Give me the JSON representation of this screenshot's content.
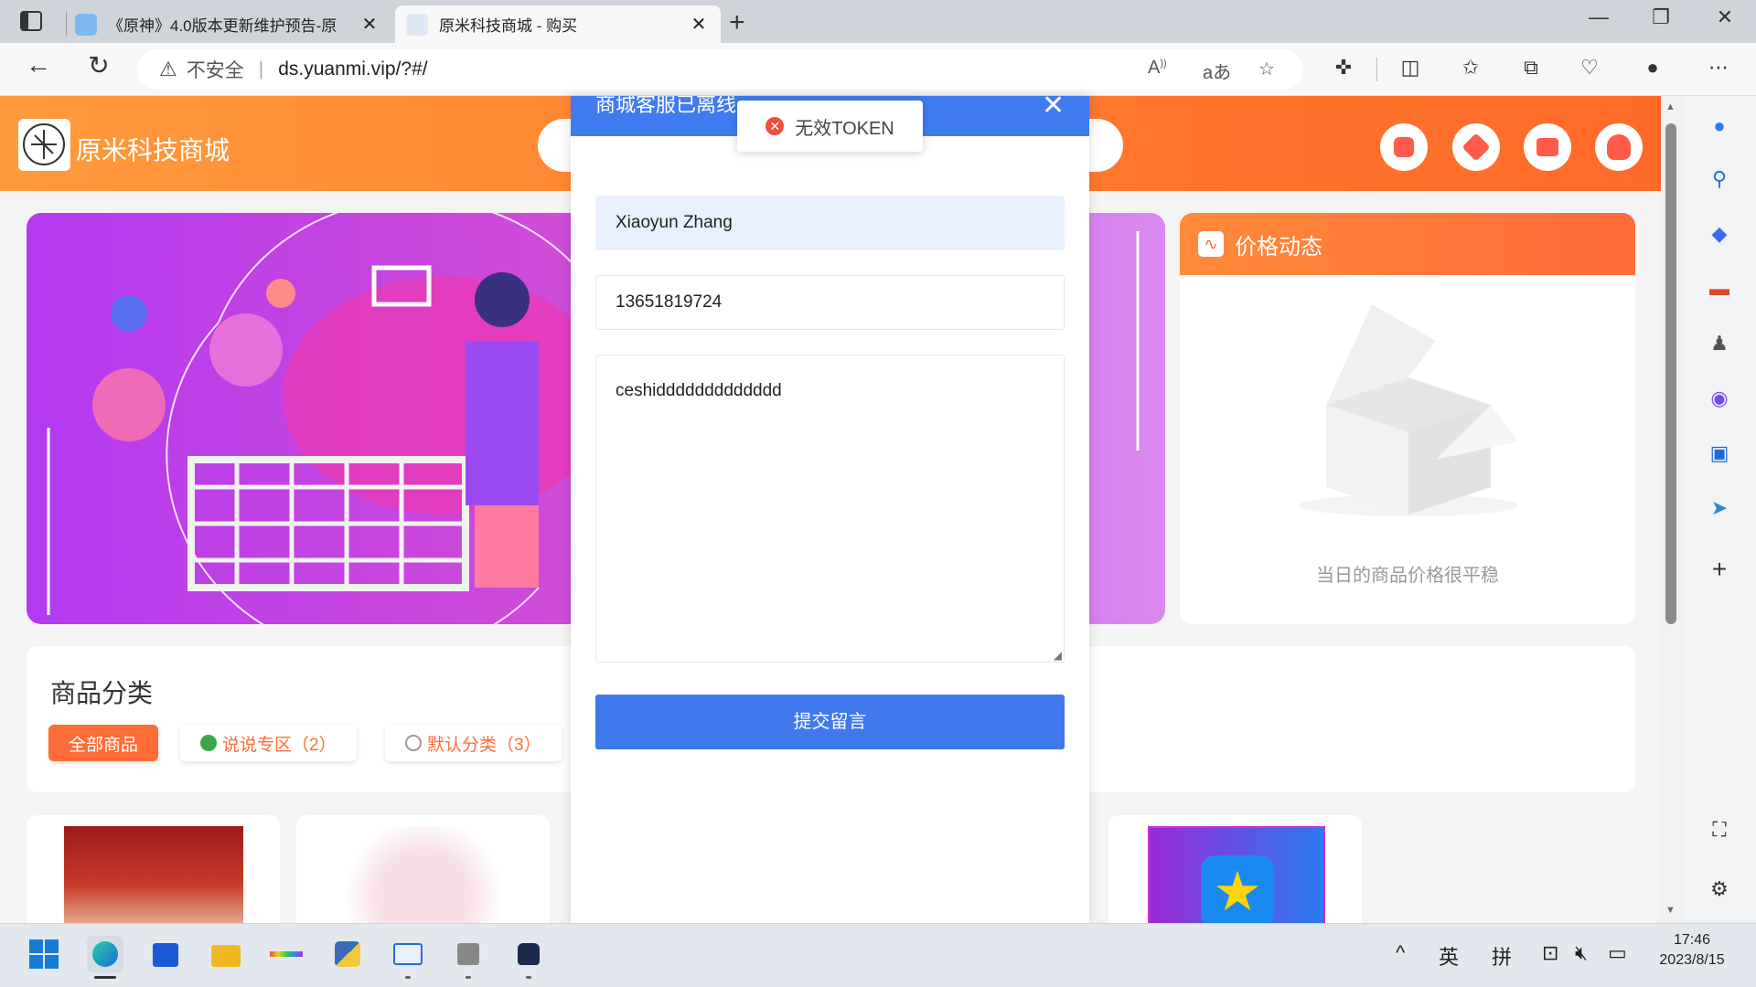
{
  "browser": {
    "tabs": [
      {
        "title": "《原神》4.0版本更新维护预告-原",
        "active": false
      },
      {
        "title": "原米科技商城 - 购买",
        "active": true
      }
    ],
    "security_label": "不安全",
    "url": "ds.yuanmi.vip/?#/",
    "icons": {
      "back": "back-arrow-icon",
      "refresh": "refresh-icon",
      "read_aloud": "read-aloud-icon",
      "translate": "translate-icon",
      "favorite": "star-icon",
      "extensions": "extensions-icon",
      "split": "split-screen-icon",
      "favorites": "favorites-icon",
      "collections": "collections-icon",
      "health": "browser-essentials-icon",
      "profile": "profile-icon",
      "more": "more-icon"
    }
  },
  "site": {
    "name": "原米科技商城",
    "price_card": {
      "title": "价格动态",
      "empty_text": "当日的商品价格很平稳"
    },
    "categories": {
      "title": "商品分类",
      "items": [
        {
          "label": "全部商品",
          "active": true
        },
        {
          "label": "说说专区（2）",
          "active": false
        },
        {
          "label": "默认分类（3）",
          "active": false
        }
      ]
    },
    "colors": {
      "brand": "#ff7a2d",
      "modal_blue": "#3f7bf0"
    }
  },
  "modal": {
    "title": "商城客服已离线",
    "name_value": "Xiaoyun Zhang",
    "phone_value": "13651819724",
    "message_value": "ceshiddddddddddddd",
    "submit_label": "提交留言"
  },
  "toast": {
    "text": "无效TOKEN"
  },
  "taskbar": {
    "ime_lang": "英",
    "ime_mode": "拼",
    "time": "17:46",
    "date": "2023/8/15"
  }
}
